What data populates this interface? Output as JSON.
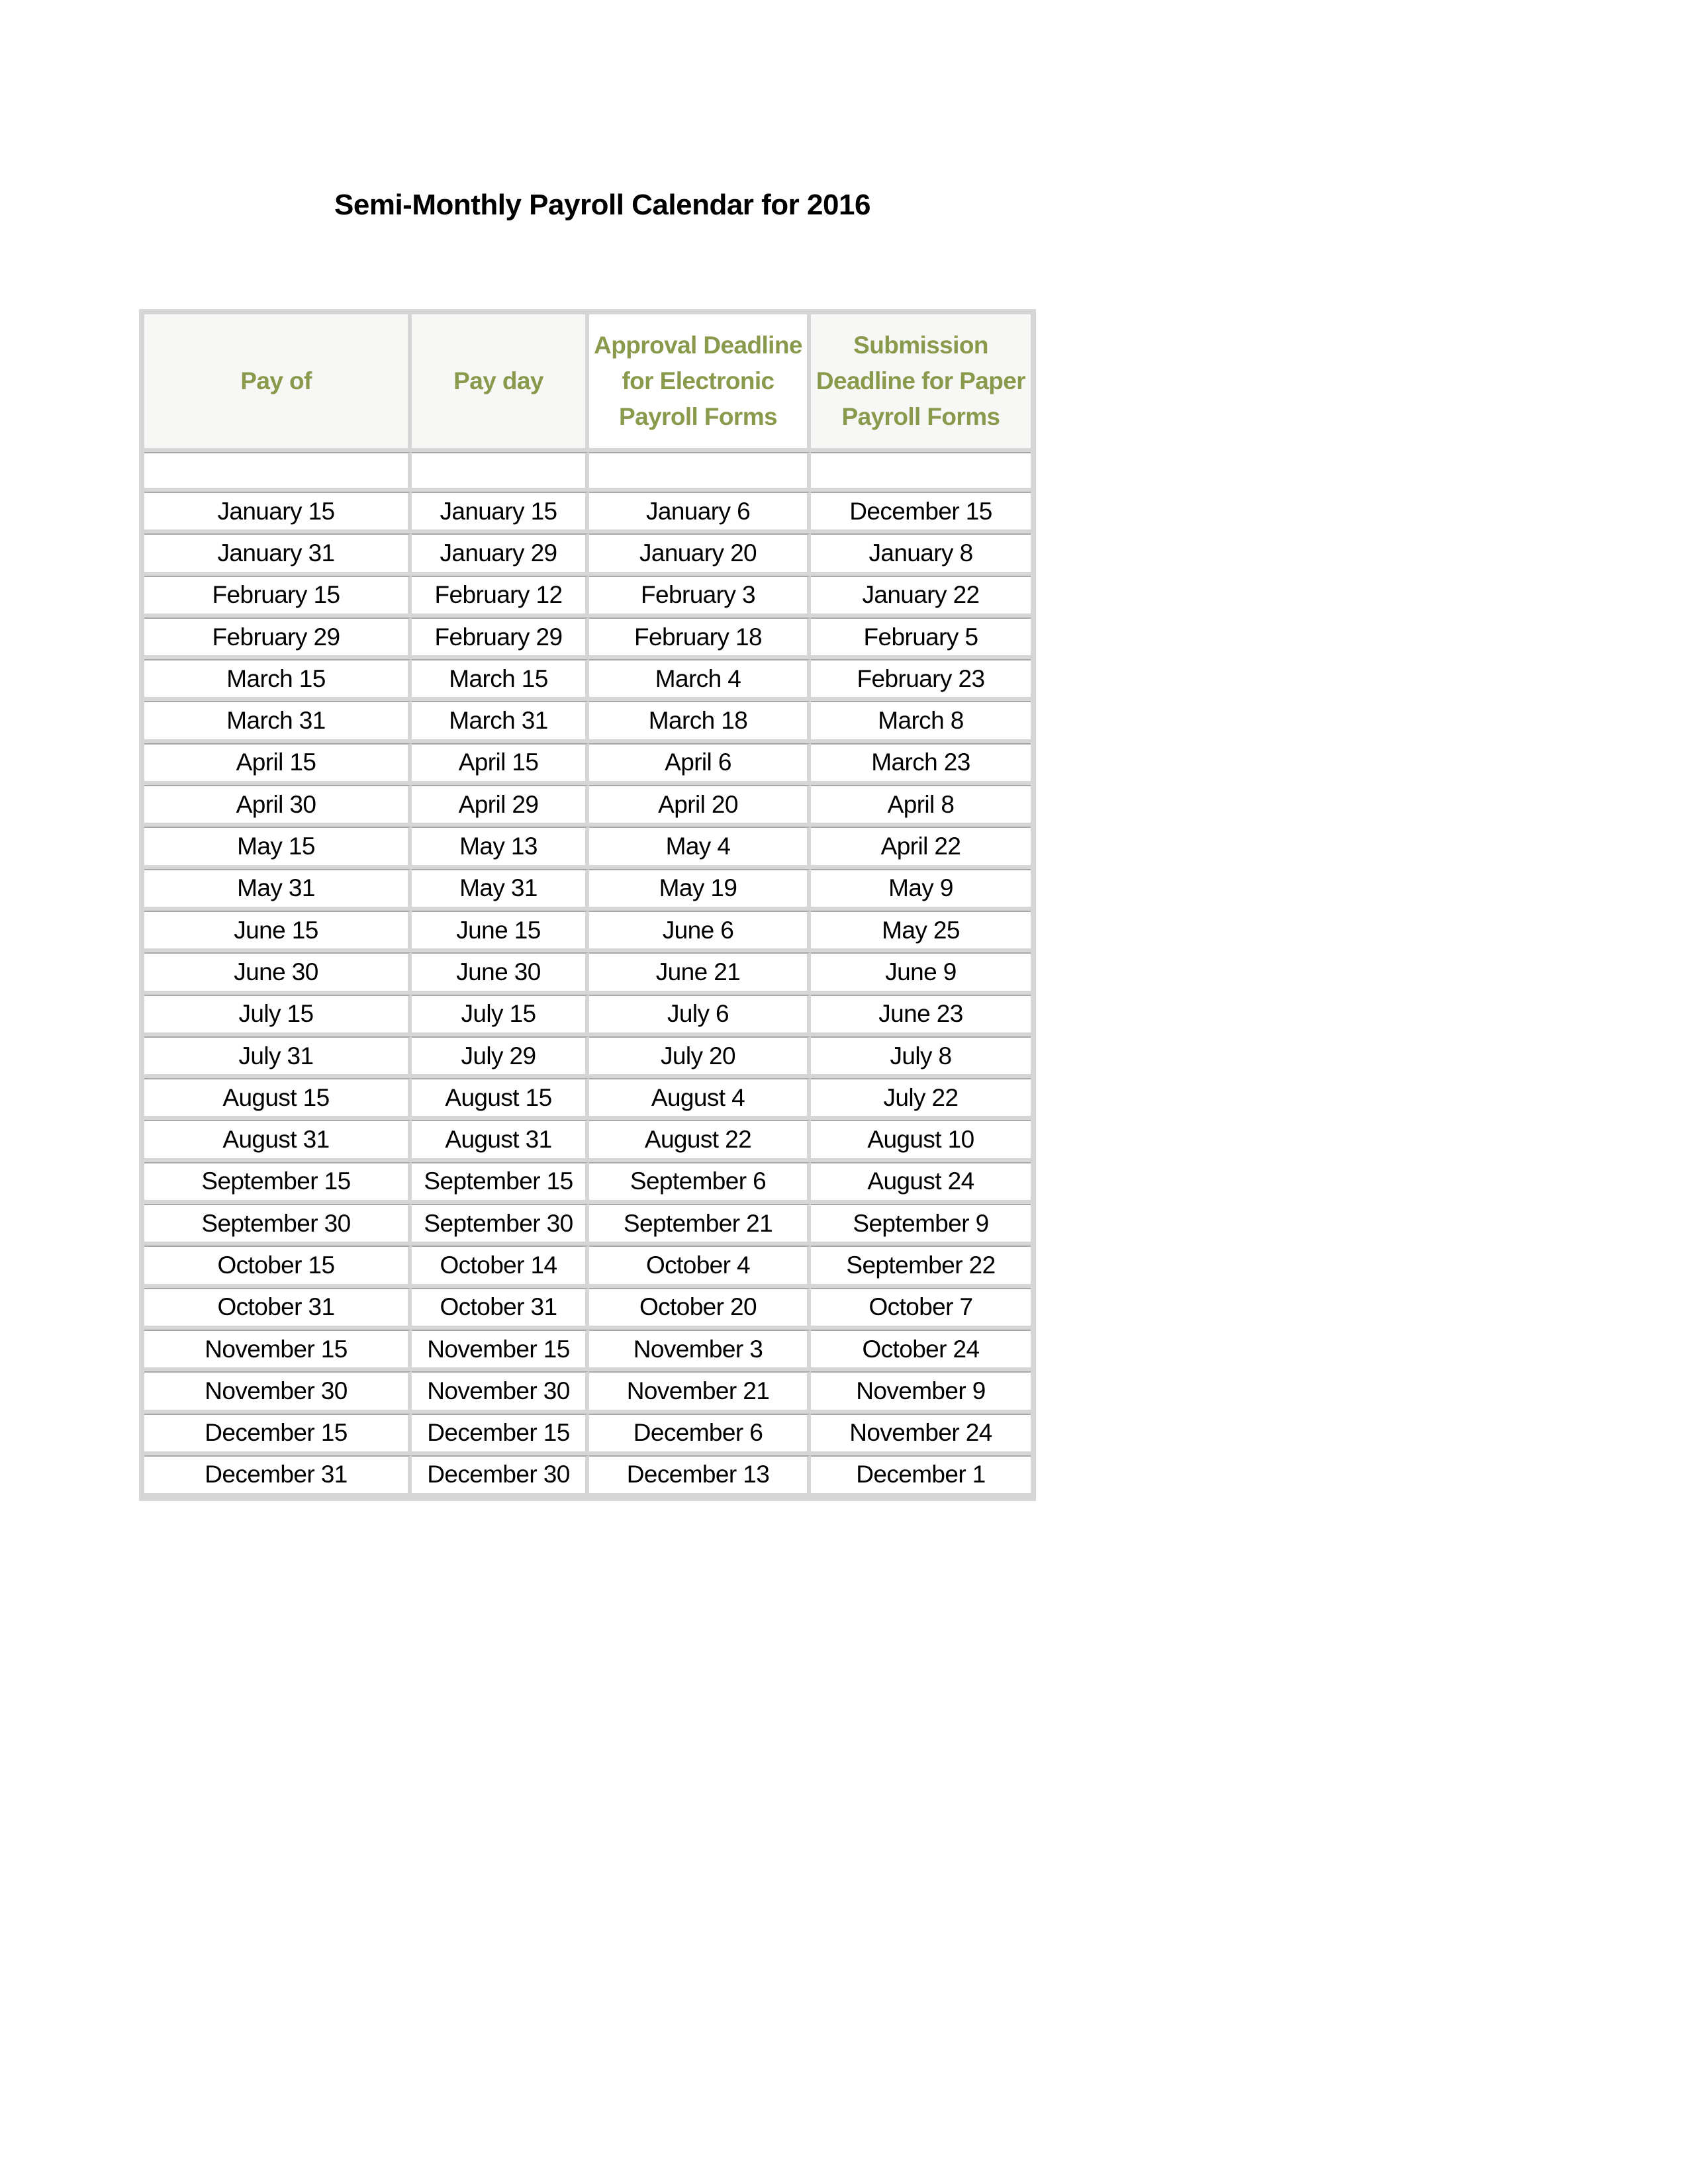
{
  "document": {
    "title": "Semi-Monthly Payroll Calendar for 2016"
  },
  "colors": {
    "header_text": "#8a9a4c",
    "header_bg": "#f7f7f5",
    "grid": "#d6d6d6",
    "body_text": "#000000"
  },
  "table": {
    "headers": [
      "Pay of",
      "Pay day",
      "Approval Deadline for Electronic Payroll Forms",
      "Submission Deadline for Paper Payroll Forms"
    ],
    "rows": [
      [
        "January 15",
        "January 15",
        "January 6",
        "December 15"
      ],
      [
        "January 31",
        "January 29",
        "January 20",
        "January 8"
      ],
      [
        "February 15",
        "February 12",
        "February 3",
        "January 22"
      ],
      [
        "February 29",
        "February 29",
        "February 18",
        "February 5"
      ],
      [
        "March 15",
        "March 15",
        "March 4",
        "February 23"
      ],
      [
        "March 31",
        "March 31",
        "March 18",
        "March 8"
      ],
      [
        "April 15",
        "April 15",
        "April 6",
        "March 23"
      ],
      [
        "April 30",
        "April 29",
        "April 20",
        "April 8"
      ],
      [
        "May 15",
        "May 13",
        "May 4",
        "April 22"
      ],
      [
        "May 31",
        "May 31",
        "May 19",
        "May 9"
      ],
      [
        "June 15",
        "June 15",
        "June 6",
        "May 25"
      ],
      [
        "June 30",
        "June 30",
        "June 21",
        "June 9"
      ],
      [
        "July 15",
        "July 15",
        "July 6",
        "June 23"
      ],
      [
        "July 31",
        "July 29",
        "July 20",
        "July 8"
      ],
      [
        "August 15",
        "August 15",
        "August 4",
        "July 22"
      ],
      [
        "August 31",
        "August 31",
        "August 22",
        "August 10"
      ],
      [
        "September 15",
        "September 15",
        "September 6",
        "August 24"
      ],
      [
        "September 30",
        "September 30",
        "September 21",
        "September 9"
      ],
      [
        "October 15",
        "October 14",
        "October 4",
        "September 22"
      ],
      [
        "October 31",
        "October 31",
        "October 20",
        "October 7"
      ],
      [
        "November 15",
        "November 15",
        "November 3",
        "October 24"
      ],
      [
        "November 30",
        "November 30",
        "November 21",
        "November 9"
      ],
      [
        "December 15",
        "December 15",
        "December 6",
        "November 24"
      ],
      [
        "December 31",
        "December 30",
        "December 13",
        "December 1"
      ]
    ]
  }
}
